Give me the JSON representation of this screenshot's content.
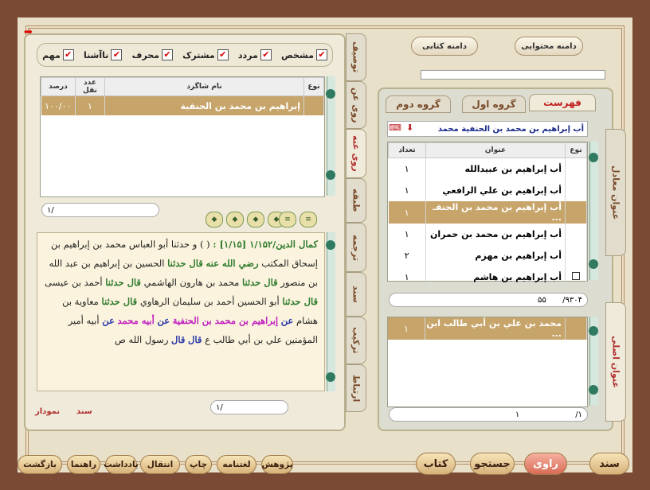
{
  "filters": [
    {
      "label": "مشخص",
      "checked": true
    },
    {
      "label": "مردد",
      "checked": true
    },
    {
      "label": "مشترک",
      "checked": true
    },
    {
      "label": "محرف",
      "checked": true
    },
    {
      "label": "ناآشنا",
      "checked": true
    },
    {
      "label": "مهم",
      "checked": true
    }
  ],
  "left_vtabs": [
    "توصیف",
    "روی عن",
    "روی عنه",
    "طبقه",
    "ترجمه",
    "سند",
    "ترکیب",
    "ارتباط"
  ],
  "students_table": {
    "headers": {
      "type": "نوع",
      "name": "نام شاگرد",
      "count": "عدد نقل",
      "percent": "درصد"
    },
    "rows": [
      {
        "name": "إبراهيم بن محمد بن الحنفية",
        "count": "۱",
        "percent": "۱۰۰/۰۰"
      }
    ]
  },
  "left_pager": "۱/",
  "hadith_text": {
    "source": "كمال الدين/۱/۱۵۲ [۱/۱۵] :",
    "p1": "( ) و حدثنا أبو العباس محمد بن إبراهيم بن إسحاق المكتب",
    "p2": "رضي الله عنه",
    "p3": "قال حدثنا",
    "p4": "الحسين بن إبراهيم بن عبد الله بن منصور",
    "p5": "قال حدثنا",
    "p6": "محمد بن هارون الهاشمي",
    "p7": "قال حدثنا",
    "p8": "أحمد بن عيسى",
    "p9": "قال حدثنا",
    "p10": "أبو الحسين أحمد بن سليمان الرهاوي",
    "p11": "قال حدثنا",
    "p12": "معاوية بن هشام",
    "p13": "عن",
    "p14": "إبراهيم بن محمد بن الحنفية",
    "p15": "عن",
    "p16": "أبيه محمد",
    "p17": "عن",
    "p18": "أبيه أمير المؤمنين علي بن أبي طالب ع",
    "p19": "قال",
    "p20": "قال",
    "p21": "رسول الله ص"
  },
  "text_pager": "۱/",
  "text_tags": {
    "sanad": "سند",
    "namudar": "نمودار"
  },
  "top_buttons": {
    "content": "دامنه محتوایی",
    "book": "دامنه کتابی"
  },
  "right_tabs": {
    "index": "فهرست",
    "group1": "گروه اول",
    "group2": "گروه دوم"
  },
  "right_side_tabs": {
    "equiv": "عنوان معادل",
    "original": "عنوان اصلی"
  },
  "header_title": "أب إبراهيم بن محمد بن الحنفية محمد",
  "titles_table": {
    "headers": {
      "type": "نوع",
      "title": "عنوان",
      "count": "تعداد"
    },
    "rows": [
      {
        "title": "أب إبراهيم بن عبيدالله",
        "count": "۱"
      },
      {
        "title": "أب إبراهيم بن علي الرافعي",
        "count": "۱"
      },
      {
        "title": "أب إبراهيم بن محمد بن الحنفـ ...",
        "count": "۱",
        "selected": true
      },
      {
        "title": "أب إبراهيم بن محمد بن حمران",
        "count": "۱"
      },
      {
        "title": "أب إبراهيم بن مهزم",
        "count": "۲"
      },
      {
        "title": "أب إبراهيم بن هاشم",
        "count": "۱",
        "checkbox": true
      }
    ]
  },
  "titles_pager": {
    "page": "۹۳۰۴/",
    "total": "۵۵"
  },
  "original_table": {
    "rows": [
      {
        "title": "محمد بن علي بن أبي طالب ابن ...",
        "count": "۱"
      }
    ]
  },
  "original_pager": {
    "page": "۱/",
    "total": "۱"
  },
  "bottom_left": [
    "بازگشت",
    "راهنما",
    "یادداشت",
    "انتقال",
    "چاپ",
    "لغتنامه",
    "پژوهش"
  ],
  "bottom_right": [
    "سند",
    "راوی",
    "جستجو",
    "کتاب"
  ]
}
